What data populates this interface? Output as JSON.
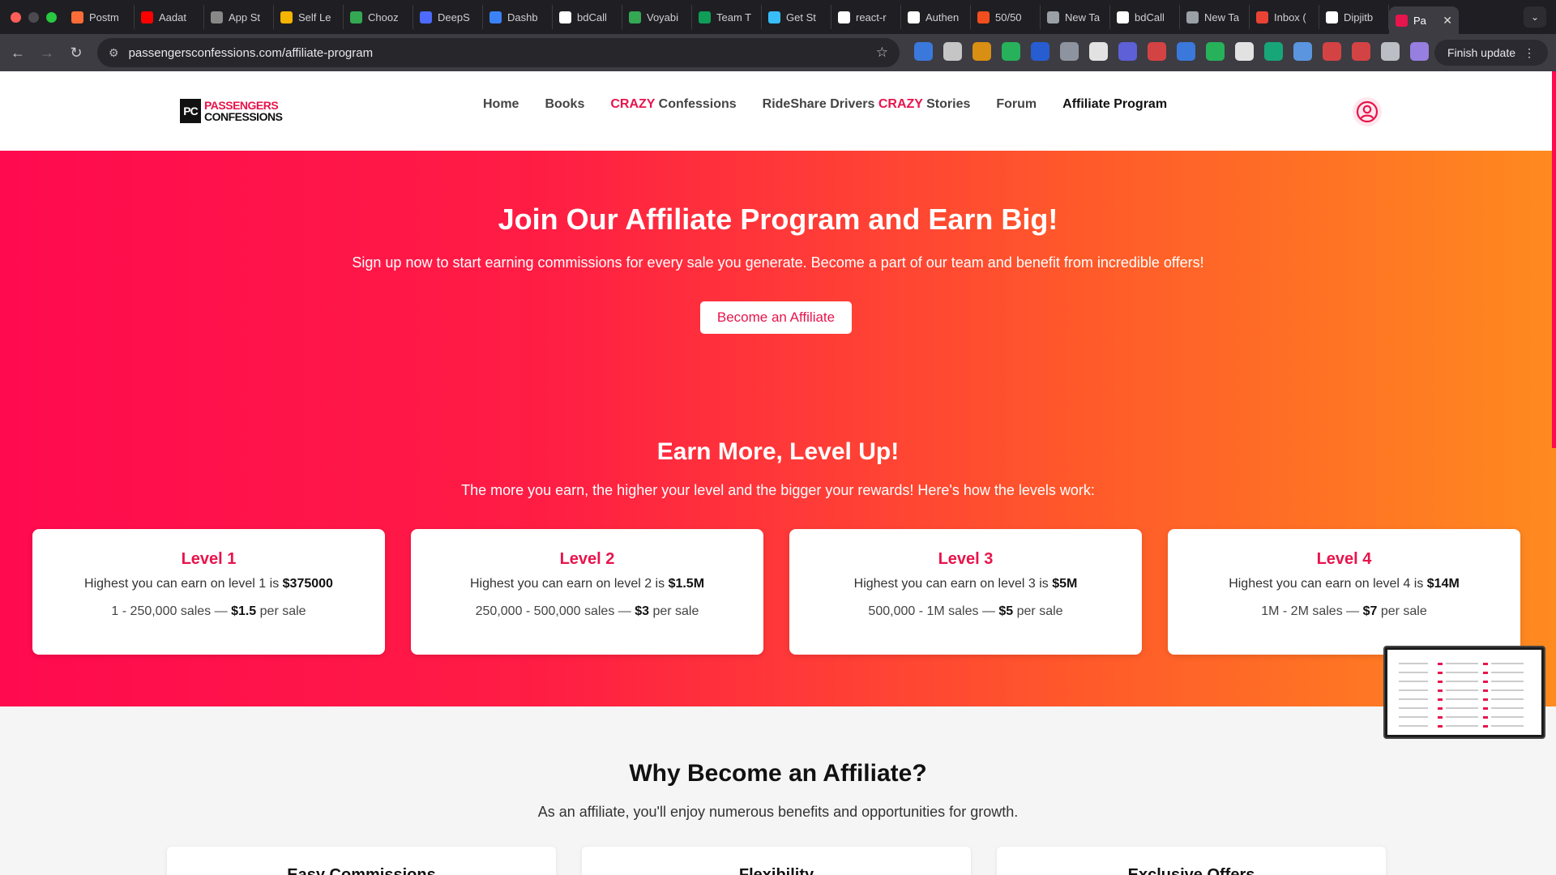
{
  "browser": {
    "tabs": [
      {
        "title": "Postm",
        "icon": "postman-icon",
        "color": "#ff6c37"
      },
      {
        "title": "Aadat",
        "icon": "youtube-icon",
        "color": "#ff0000"
      },
      {
        "title": "App St",
        "icon": "apple-icon",
        "color": "#888888"
      },
      {
        "title": "Self Le",
        "icon": "sheet-icon",
        "color": "#f4b400"
      },
      {
        "title": "Chooz",
        "icon": "drive-icon",
        "color": "#34a853"
      },
      {
        "title": "DeepS",
        "icon": "deepseek-icon",
        "color": "#4d6bfe"
      },
      {
        "title": "Dashb",
        "icon": "dashboard-icon",
        "color": "#3b82f6"
      },
      {
        "title": "bdCall",
        "icon": "github-icon",
        "color": "#ffffff"
      },
      {
        "title": "Voyabi",
        "icon": "drive-icon",
        "color": "#34a853"
      },
      {
        "title": "Team T",
        "icon": "sheets-icon",
        "color": "#0f9d58"
      },
      {
        "title": "Get St",
        "icon": "gear-icon",
        "color": "#38bdf8"
      },
      {
        "title": "react-r",
        "icon": "github-icon",
        "color": "#ffffff"
      },
      {
        "title": "Authen",
        "icon": "openai-icon",
        "color": "#ffffff"
      },
      {
        "title": "50/50",
        "icon": "figma-icon",
        "color": "#f24e1e"
      },
      {
        "title": "New Ta",
        "icon": "chrome-icon",
        "color": "#9aa0a6"
      },
      {
        "title": "bdCall",
        "icon": "github-icon",
        "color": "#ffffff"
      },
      {
        "title": "New Ta",
        "icon": "chrome-icon",
        "color": "#9aa0a6"
      },
      {
        "title": "Inbox (",
        "icon": "gmail-icon",
        "color": "#ea4335"
      },
      {
        "title": "Dipjitb",
        "icon": "github-icon",
        "color": "#ffffff"
      },
      {
        "title": "Pa",
        "icon": "site-icon",
        "color": "#e8144c"
      }
    ],
    "url": "passengersconfessions.com/affiliate-program",
    "finish_update": "Finish update",
    "extensions": [
      "#3b82f6",
      "#dddddd",
      "#f59e0b",
      "#22c55e",
      "#2563eb",
      "#9ca3af",
      "#ffffff",
      "#6366f1",
      "#ef4444",
      "#3b82f6",
      "#22c55e",
      "#ffffff",
      "#10b981",
      "#60a5fa",
      "#ef4444",
      "#ef4444",
      "#d1d5db",
      "#a78bfa"
    ]
  },
  "site": {
    "logo_top": "PASSENGERS",
    "logo_bottom": "CONFESSIONS",
    "logo_mark": "PC",
    "nav": {
      "home": "Home",
      "books": "Books",
      "crazy_confessions_hl": "CRAZY",
      "crazy_confessions_rest": " Confessions",
      "rideshare_pre": "RideShare Drivers ",
      "rideshare_hl": "CRAZY",
      "rideshare_post": " Stories",
      "forum": "Forum",
      "affiliate": "Affiliate Program"
    }
  },
  "hero": {
    "title": "Join Our Affiliate Program and Earn Big!",
    "subtitle": "Sign up now to start earning commissions for every sale you generate. Become a part of our team and benefit from incredible offers!",
    "cta": "Become an Affiliate",
    "levels_title": "Earn More, Level Up!",
    "levels_subtitle": "The more you earn, the higher your level and the bigger your rewards! Here's how the levels work:"
  },
  "levels": [
    {
      "name": "Level 1",
      "earn_pre": "Highest you can earn on level 1 is ",
      "earn_val": "$375000",
      "range": "1 - 250,000 sales — ",
      "rate": "$1.5",
      "per": " per sale"
    },
    {
      "name": "Level 2",
      "earn_pre": "Highest you can earn on level 2 is ",
      "earn_val": "$1.5M",
      "range": "250,000 - 500,000 sales — ",
      "rate": "$3",
      "per": " per sale"
    },
    {
      "name": "Level 3",
      "earn_pre": "Highest you can earn on level 3 is ",
      "earn_val": "$5M",
      "range": "500,000 - 1M sales — ",
      "rate": "$5",
      "per": " per sale"
    },
    {
      "name": "Level 4",
      "earn_pre": "Highest you can earn on level 4 is ",
      "earn_val": "$14M",
      "range": "1M - 2M sales — ",
      "rate": "$7",
      "per": " per sale"
    }
  ],
  "why": {
    "title": "Why Become an Affiliate?",
    "subtitle": "As an affiliate, you'll enjoy numerous benefits and opportunities for growth.",
    "cards": [
      "Easy Commissions",
      "Flexibility",
      "Exclusive Offers"
    ]
  },
  "colors": {
    "brand": "#e8144c",
    "hero_gradient_start": "#ff0a4f",
    "hero_gradient_end": "#ff8a1f"
  }
}
